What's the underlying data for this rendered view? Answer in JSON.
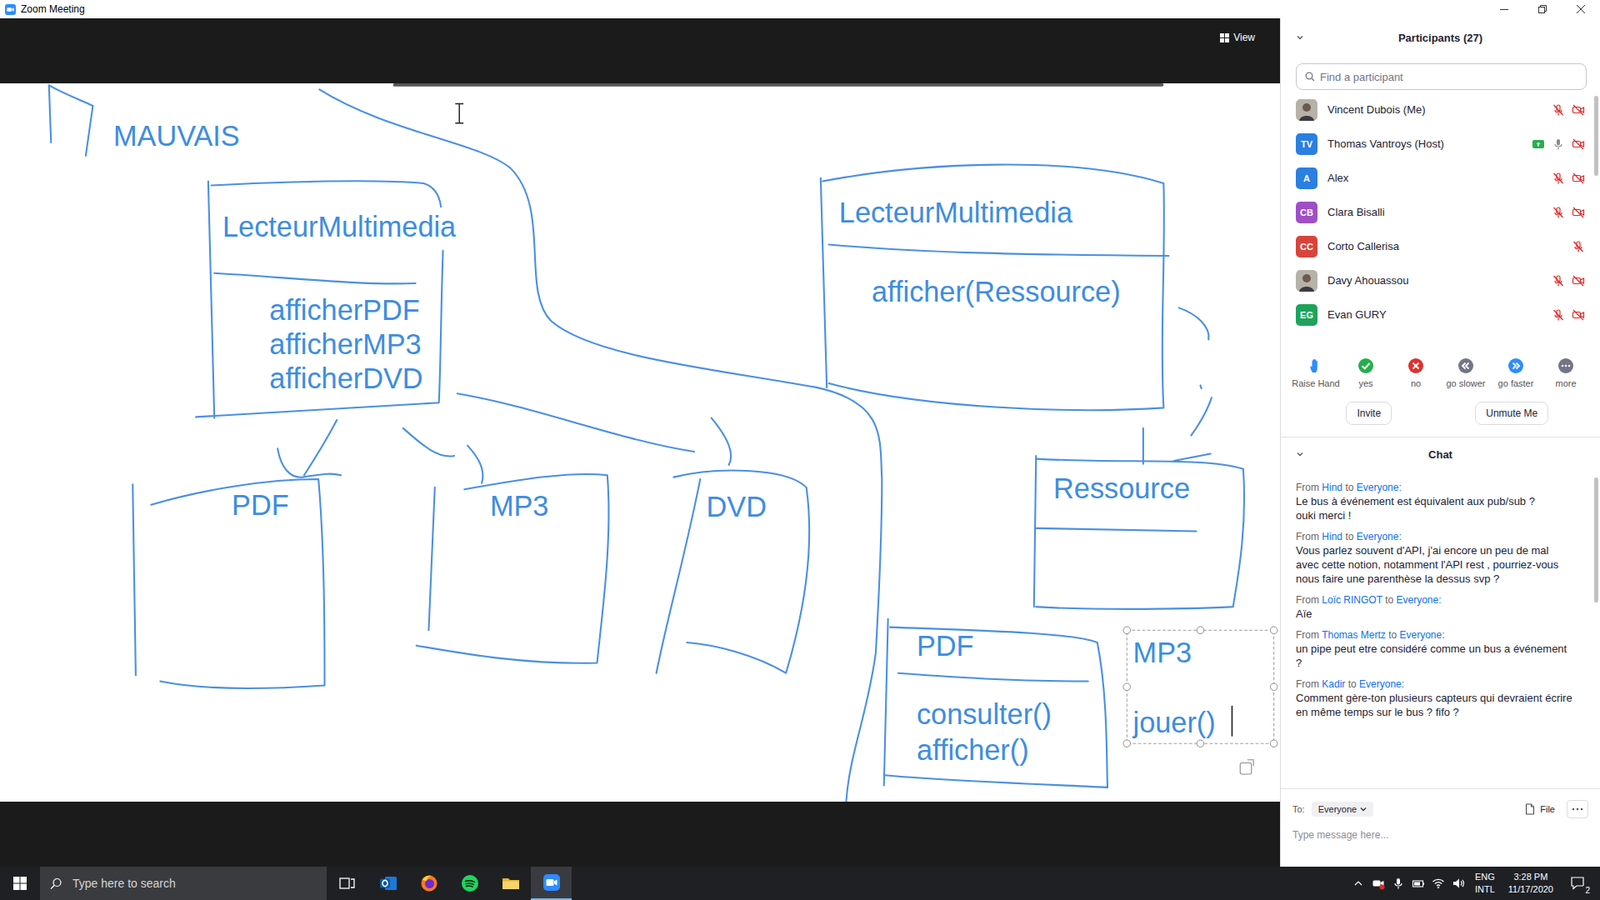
{
  "window": {
    "title": "Zoom Meeting"
  },
  "meeting": {
    "view_label": "View"
  },
  "whiteboard": {
    "heading": "MAUVAIS",
    "boxes": [
      {
        "title": "LecteurMultimedia",
        "members": [
          "afficherPDF",
          "afficherMP3",
          "afficherDVD"
        ],
        "selected": false
      },
      {
        "title": "PDF",
        "members": [],
        "selected": false
      },
      {
        "title": "MP3",
        "members": [],
        "selected": false
      },
      {
        "title": "DVD",
        "members": [],
        "selected": false
      },
      {
        "title": "LecteurMultimedia",
        "members": [
          "afficher(Ressource)"
        ],
        "selected": false
      },
      {
        "title": "Ressource",
        "members": [],
        "selected": false
      },
      {
        "title": "PDF",
        "members": [
          "consulter()",
          "afficher()"
        ],
        "selected": false
      },
      {
        "title": "MP3",
        "members": [
          "jouer()"
        ],
        "selected": true
      }
    ]
  },
  "participants": {
    "title": "Participants (27)",
    "expanded": true,
    "search_placeholder": "Find a participant",
    "people": [
      {
        "name": "Vincent Dubois (Me)",
        "kind": "photo",
        "muted": true,
        "video_off": true,
        "sharing": false
      },
      {
        "name": "Thomas Vantroys (Host)",
        "kind": "initials",
        "initials": "TV",
        "color": "#2b7fe0",
        "muted": false,
        "video_off": true,
        "sharing": true
      },
      {
        "name": "Alex",
        "kind": "initials",
        "initials": "A",
        "color": "#2b7fe0",
        "muted": true,
        "video_off": true,
        "sharing": false
      },
      {
        "name": "Clara Bisalli",
        "kind": "initials",
        "initials": "CB",
        "color": "#a04ec6",
        "muted": true,
        "video_off": true,
        "sharing": false
      },
      {
        "name": "Corto Callerisa",
        "kind": "initials",
        "initials": "CC",
        "color": "#d9443a",
        "muted": true,
        "video_off": false,
        "sharing": false
      },
      {
        "name": "Davy Ahouassou",
        "kind": "photo",
        "muted": true,
        "video_off": true,
        "sharing": false
      },
      {
        "name": "Evan GURY",
        "kind": "initials",
        "initials": "EG",
        "color": "#1fa35b",
        "muted": true,
        "video_off": true,
        "sharing": false
      }
    ]
  },
  "reactions": [
    {
      "label": "Raise Hand",
      "kind": "hand",
      "color": "#2d8cff"
    },
    {
      "label": "yes",
      "kind": "check",
      "color": "#23b04b"
    },
    {
      "label": "no",
      "kind": "cross",
      "color": "#e0302f"
    },
    {
      "label": "go slower",
      "kind": "slower",
      "color": "#747487"
    },
    {
      "label": "go faster",
      "kind": "faster",
      "color": "#2d8cff"
    },
    {
      "label": "more",
      "kind": "more",
      "color": "#747487"
    }
  ],
  "actions": [
    {
      "label": "Invite"
    },
    {
      "label": "Unmute Me"
    }
  ],
  "chat": {
    "title": "Chat",
    "expanded": true,
    "from_word": "From",
    "to_word": "to",
    "messages": [
      {
        "sender": "Hind",
        "recipient": "Everyone:",
        "lines": [
          "Le bus à événement est équivalent aux pub/sub ?",
          "ouki merci !"
        ]
      },
      {
        "sender": "Hind",
        "recipient": "Everyone:",
        "lines": [
          "Vous parlez souvent d'API, j'ai encore un peu de mal avec cette notion, notamment l'API rest , pourriez-vous nous faire une parenthèse la dessus svp ?"
        ]
      },
      {
        "sender": "Loïc RINGOT",
        "recipient": "Everyone:",
        "lines": [
          "Aïe"
        ]
      },
      {
        "sender": "Thomas Mertz",
        "recipient": "Everyone:",
        "lines": [
          "un pipe peut etre considéré comme un bus a événement ?"
        ]
      },
      {
        "sender": "Kadir",
        "recipient": "Everyone:",
        "lines": [
          "Comment gère-ton plusieurs capteurs qui devraient écrire en même temps sur le bus ? fifo ?"
        ]
      }
    ],
    "composer": {
      "to_label": "To:",
      "recipient": "Everyone",
      "file_label": "File",
      "placeholder": "Type message here..."
    }
  },
  "taskbar": {
    "search_placeholder": "Type here to search",
    "apps": [
      {
        "kind": "task-view",
        "active": false
      },
      {
        "kind": "outlook",
        "active": false
      },
      {
        "kind": "firefox",
        "active": false
      },
      {
        "kind": "spotify",
        "active": false
      },
      {
        "kind": "explorer",
        "active": false
      },
      {
        "kind": "zoom",
        "active": true
      }
    ],
    "language": "ENG",
    "layout": "INTL",
    "time": "3:28 PM",
    "date": "11/17/2020",
    "notifications": "2"
  }
}
